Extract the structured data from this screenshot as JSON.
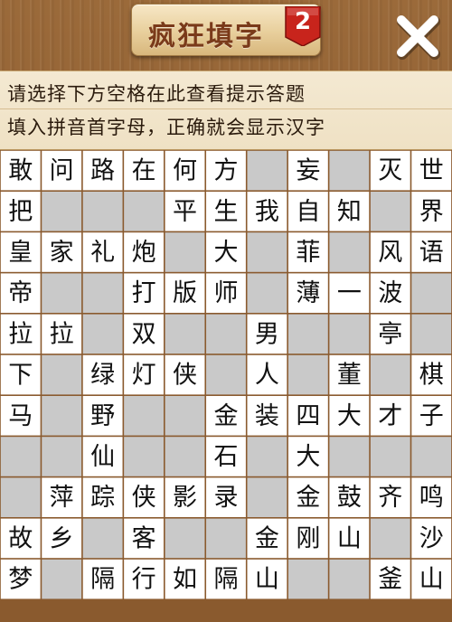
{
  "header": {
    "title": "疯狂填字",
    "level": "2",
    "close_icon": "close-icon"
  },
  "hint": {
    "line1": "请选择下方空格在此查看提示答题",
    "line2": "填入拼音首字母，正确就会显示汉字"
  },
  "colors": {
    "cell_empty": "#c9c9c9",
    "cell_letter": "#ffffff",
    "grid_line": "#8a5a2e",
    "title_text": "#7a3a1a",
    "badge_red": "#c8241c"
  },
  "grid": {
    "rows": 11,
    "cols": 11,
    "cells": [
      [
        "敢",
        "问",
        "路",
        "在",
        "何",
        "方",
        "",
        "妄",
        "",
        "灭",
        "世"
      ],
      [
        "把",
        "",
        "",
        "",
        "平",
        "生",
        "我",
        "自",
        "知",
        "",
        "界"
      ],
      [
        "皇",
        "家",
        "礼",
        "炮",
        "",
        "大",
        "",
        "菲",
        "",
        "风",
        "语"
      ],
      [
        "帝",
        "",
        "",
        "打",
        "版",
        "师",
        "",
        "薄",
        "一",
        "波",
        ""
      ],
      [
        "拉",
        "拉",
        "",
        "双",
        "",
        "",
        "男",
        "",
        "",
        "亭",
        ""
      ],
      [
        "下",
        "",
        "绿",
        "灯",
        "侠",
        "",
        "人",
        "",
        "董",
        "",
        "棋"
      ],
      [
        "马",
        "",
        "野",
        "",
        "",
        "金",
        "装",
        "四",
        "大",
        "才",
        "子"
      ],
      [
        "",
        "",
        "仙",
        "",
        "",
        "石",
        "",
        "大",
        "",
        "",
        ""
      ],
      [
        "",
        "萍",
        "踪",
        "侠",
        "影",
        "录",
        "",
        "金",
        "鼓",
        "齐",
        "鸣"
      ],
      [
        "故",
        "乡",
        "",
        "客",
        "",
        "",
        "金",
        "刚",
        "山",
        "",
        "沙"
      ],
      [
        "梦",
        "",
        "隔",
        "行",
        "如",
        "隔",
        "山",
        "",
        "",
        "釜",
        "山"
      ]
    ]
  }
}
